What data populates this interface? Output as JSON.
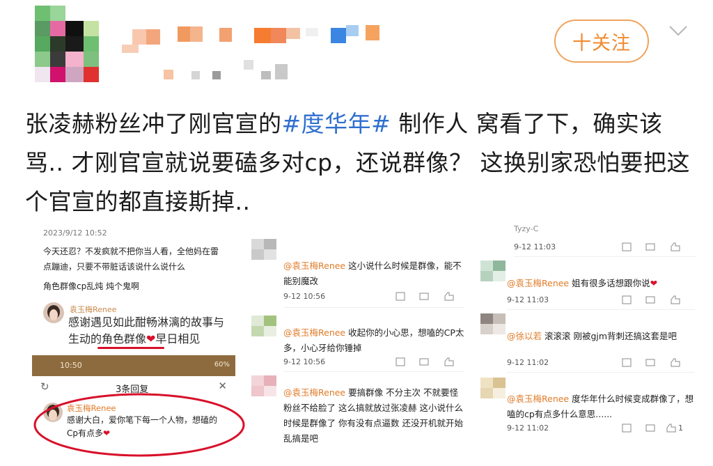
{
  "header": {
    "follow_label": "十关注"
  },
  "post": {
    "text_before": "张凌赫粉丝冲了刚官宣的",
    "hashtag": "#度华年#",
    "text_after": " 制作人 窝看了下，确实该骂.. 才刚官宣就说要磕多对cp，还说群像？ 这换别家恐怕要把这个官宣的都直接斯掉.."
  },
  "left_panel": {
    "timestamp": "2023/9/12 10:52",
    "complaint": "今天还忍？不发疯就不把你当人看，全他妈在雷点蹦迪，只要不带脏话该说什么说什么",
    "complaint_2": "角色群像cp乱炖 炖个鬼啊",
    "handwritten_author": "袁玉梅Renee",
    "handwritten_text_1": "感谢遇见如此酣畅淋漓的故事与",
    "handwritten_text_2": "生动的角色群像",
    "handwritten_text_3": "早日相见",
    "phone_time": "10:50",
    "phone_battery": "60%",
    "reply_header": "3条回复",
    "reply_author": "袁玉梅Renee",
    "reply_text": "感谢大白，爱你笔下每一个人物，想磕的Cp有点多"
  },
  "middle_panel": {
    "comments": [
      {
        "user": "@袁玉梅Renee",
        "text": "这小说什么时候是群像，能不能别魔改",
        "time": "9-12 10:56"
      },
      {
        "user": "@袁玉梅Renee",
        "text": "收起你的小心思，想嗑的CP太多，小心牙给你锤掉",
        "time": "9-12 10:56"
      },
      {
        "user": "@袁玉梅Renee",
        "text": "要搞群像 不分主次 不就要怪粉丝不给脸了 这么搞就放过张凌赫 这小说什么时候是群像了 你有没有点逼数 还没开机就开始乱搞是吧",
        "time": ""
      }
    ]
  },
  "right_panel": {
    "top_fragment": "Tyzy-C",
    "comments": [
      {
        "user": "",
        "text": "",
        "time": "9-12 11:03"
      },
      {
        "user": "@袁玉梅Renee",
        "text": "姐有很多话想跟你说",
        "time": "9-12 11:03"
      },
      {
        "user": "@徐以若",
        "text": "滚滚滚 刚被gjm背刺还搞这套是吧",
        "time": "9-12 11:02"
      },
      {
        "user": "@袁玉梅Renee",
        "text": "度华年什么时候变成群像了，想嗑的cp有点多什么意思......",
        "time": "9-12 11:02",
        "likes": "1"
      }
    ]
  },
  "colors": {
    "accent_orange": "#f08a2e",
    "hashtag_blue": "#2f6fcf",
    "circle_red": "#d8102a"
  }
}
